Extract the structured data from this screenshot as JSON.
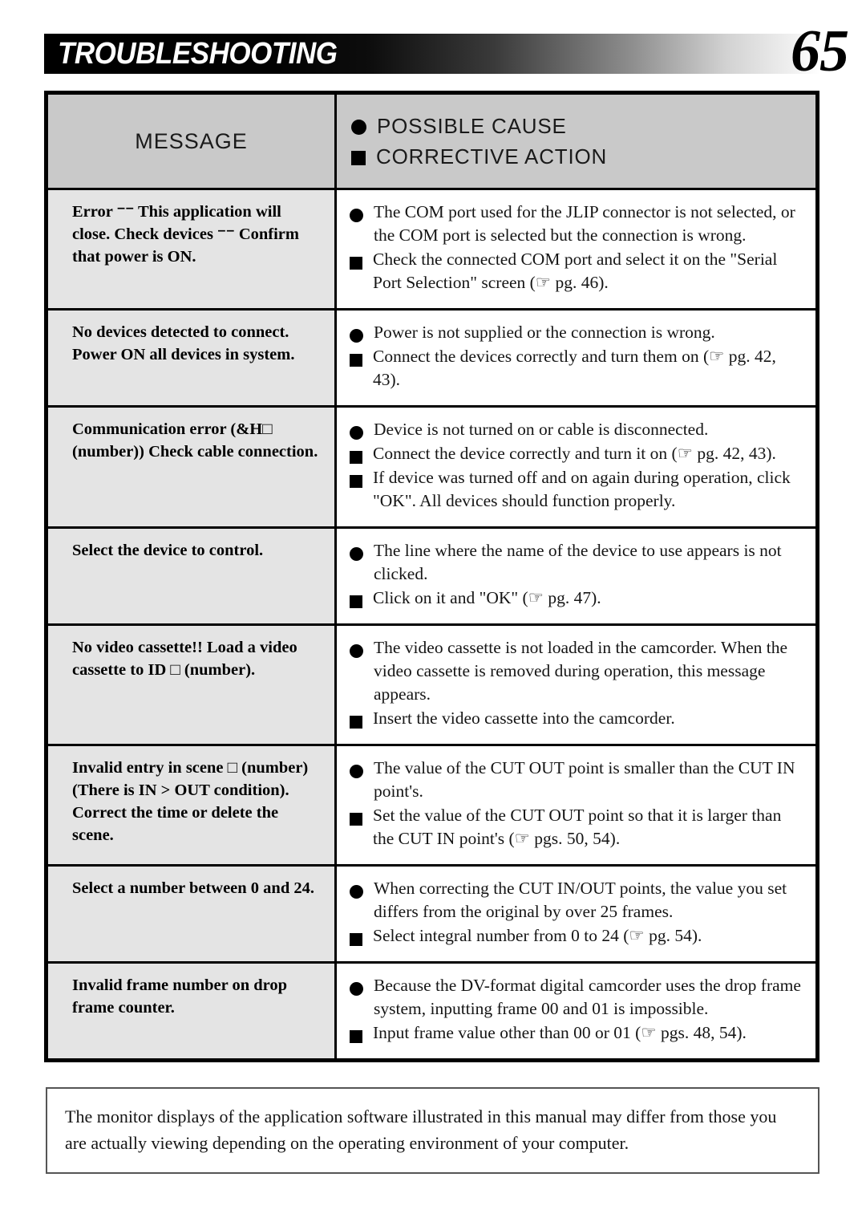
{
  "header": {
    "title": "TROUBLESHOOTING",
    "page_number": "65"
  },
  "table": {
    "columns": {
      "message_label": "MESSAGE",
      "possible_cause_label": "POSSIBLE CAUSE",
      "corrective_action_label": "CORRECTIVE ACTION",
      "cause_bullet": "circle-bullet",
      "action_bullet": "square-bullet"
    },
    "rows": [
      {
        "message": "Error ⁻⁻ This application will close.\nCheck devices ⁻⁻ Confirm that power is ON.",
        "items": [
          {
            "type": "cause",
            "text": "The COM port used for the JLIP connector is not selected, or the COM port is selected but the connection is wrong."
          },
          {
            "type": "action",
            "text": "Check the connected COM port and select it on the \"Serial Port Selection\" screen (☞ pg. 46)."
          }
        ]
      },
      {
        "message": "No devices detected to connect.\nPower ON all devices in system.",
        "items": [
          {
            "type": "cause",
            "text": "Power is not supplied or the connection is wrong."
          },
          {
            "type": "action",
            "text": "Connect the devices correctly and turn them on (☞ pg. 42, 43)."
          }
        ]
      },
      {
        "message": "Communication error (&H□ (number))\nCheck cable connection.",
        "items": [
          {
            "type": "cause",
            "text": "Device is not turned on or cable is disconnected."
          },
          {
            "type": "action",
            "text": "Connect the device correctly and turn it on (☞ pg. 42, 43)."
          },
          {
            "type": "action",
            "text": "If device was turned off and on again during operation, click \"OK\". All devices should function properly."
          }
        ]
      },
      {
        "message": "Select the device to control.",
        "items": [
          {
            "type": "cause",
            "text": "The line where the name of the device to use appears is not clicked."
          },
          {
            "type": "action",
            "text": "Click on it and \"OK\" (☞ pg. 47)."
          }
        ]
      },
      {
        "message": "No video cassette!!\nLoad a video cassette to ID □ (number).",
        "items": [
          {
            "type": "cause",
            "text": "The video cassette is not loaded in the camcorder. When the video cassette is removed during operation, this message appears."
          },
          {
            "type": "action",
            "text": "Insert the video cassette into the camcorder."
          }
        ]
      },
      {
        "message": "Invalid entry in scene □ (number) (There is IN > OUT condition). Correct the time or delete the scene.",
        "items": [
          {
            "type": "cause",
            "text": "The value of the CUT OUT point is smaller than the CUT IN point's."
          },
          {
            "type": "action",
            "text": "Set the value of the CUT OUT point so that it is larger than the CUT IN point's (☞ pgs. 50, 54)."
          }
        ]
      },
      {
        "message": "Select a number between 0 and 24.",
        "items": [
          {
            "type": "cause",
            "text": "When correcting the CUT IN/OUT points, the value you set differs from the original by over 25 frames."
          },
          {
            "type": "action",
            "text": "Select integral number from 0 to 24 (☞ pg. 54)."
          }
        ]
      },
      {
        "message": "Invalid frame number on drop frame counter.",
        "items": [
          {
            "type": "cause",
            "text": "Because the DV-format digital camcorder uses the drop frame system, inputting frame 00 and 01 is impossible."
          },
          {
            "type": "action",
            "text": "Input frame value other than 00 or 01 (☞ pgs. 48, 54)."
          }
        ]
      }
    ]
  },
  "note": {
    "text": "The monitor displays of the application software illustrated in this manual may differ from those you are actually viewing depending on the operating environment of your computer."
  }
}
